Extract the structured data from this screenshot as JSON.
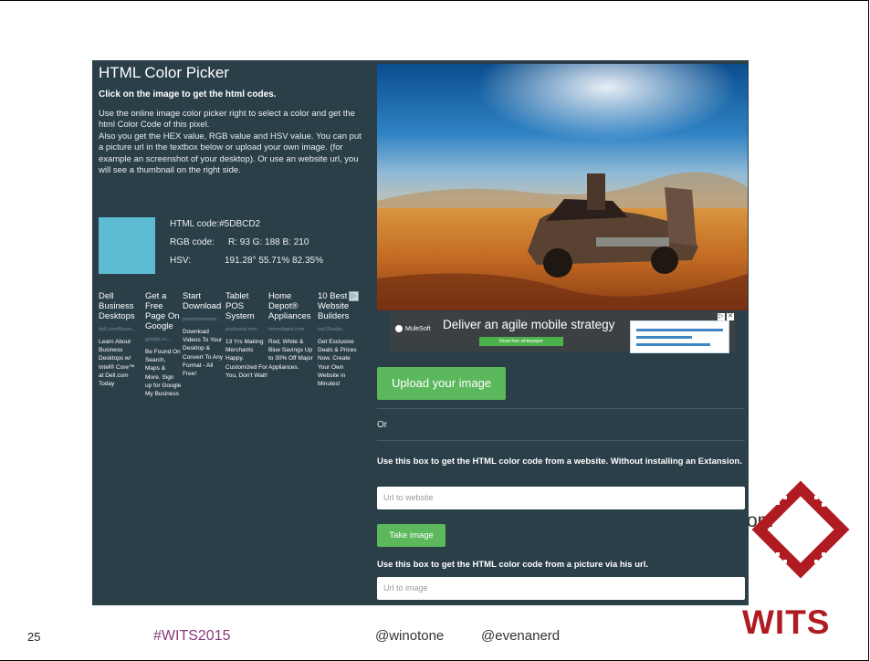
{
  "app": {
    "title": "HTML Color Picker",
    "subtitle": "Click on the image to get the html codes.",
    "intro": [
      "Use the online image color picker right to select a color and get the html Color Code of this pixel.",
      "Also you get the HEX value, RGB value and HSV value. You can put a picture url in the textbox below or upload your own image. (for example an screenshot of your desktop). Or use an website url, you will see a thumbnail on the right side."
    ],
    "color": {
      "swatch_hex": "#5DBCD2",
      "html_label": "HTML code:",
      "html_value": "#5DBCD2",
      "rgb_label": "RGB code:",
      "rgb_value": "R: 93 G: 188 B: 210",
      "hsv_label": "HSV:",
      "hsv_value": "191.28° 55.71% 82.35%"
    },
    "ads": [
      {
        "title": "Dell Business Desktops",
        "url": "dell.com/Busin...",
        "desc": "Learn About Business Desktops w/ Intel® Core™ at Dell.com Today"
      },
      {
        "title": "Get a Free Page On Google",
        "url": "google.co...",
        "desc": "Be Found On Search, Maps & More. Sign up for Google My Business"
      },
      {
        "title": "Start Download",
        "url": "ptaskdownload...",
        "desc": "Download Videos To Your Desktop & Convert To Any Format - All Free!"
      },
      {
        "title": "Tablet POS System",
        "url": "posbrand.com",
        "desc": "13 Yrs Making Merchants Happy. Customized For You, Don't Wait!"
      },
      {
        "title": "Home Depot® Appliances",
        "url": "homedepot.com",
        "desc": "Red, White & Blue Savings Up to 30% Off Major Appliances."
      },
      {
        "title": "10 Best Website Builders",
        "url": "top10webs...",
        "desc": "Get Exclusive Deals & Prices Now. Create Your Own Website in Minutes!"
      }
    ],
    "banner": {
      "brand": "MuleSoft",
      "text": "Deliver an agile mobile strategy",
      "cta": "Read free whitepaper"
    },
    "upload_label": "Upload your image",
    "or_label": "Or",
    "website_prompt": "Use this box to get the HTML color code from a website. Without installing an Extansion.",
    "website_placeholder": "Url to website",
    "take_image_label": "Take image",
    "url_prompt": "Use this box to get the HTML color code from a picture via his url.",
    "image_placeholder": "Url to image"
  },
  "slide": {
    "page_number": "25",
    "hashtag": "#WITS2015",
    "handle_1": "@winotone",
    "handle_2": "@evenanerd",
    "logo_text": "WITS",
    "overlay_fragment": "om"
  },
  "colors": {
    "panel_bg": "#2b3f49",
    "button_green": "#5cb85c",
    "brand_red": "#b01b22",
    "hashtag_purple": "#8a3a7a"
  }
}
